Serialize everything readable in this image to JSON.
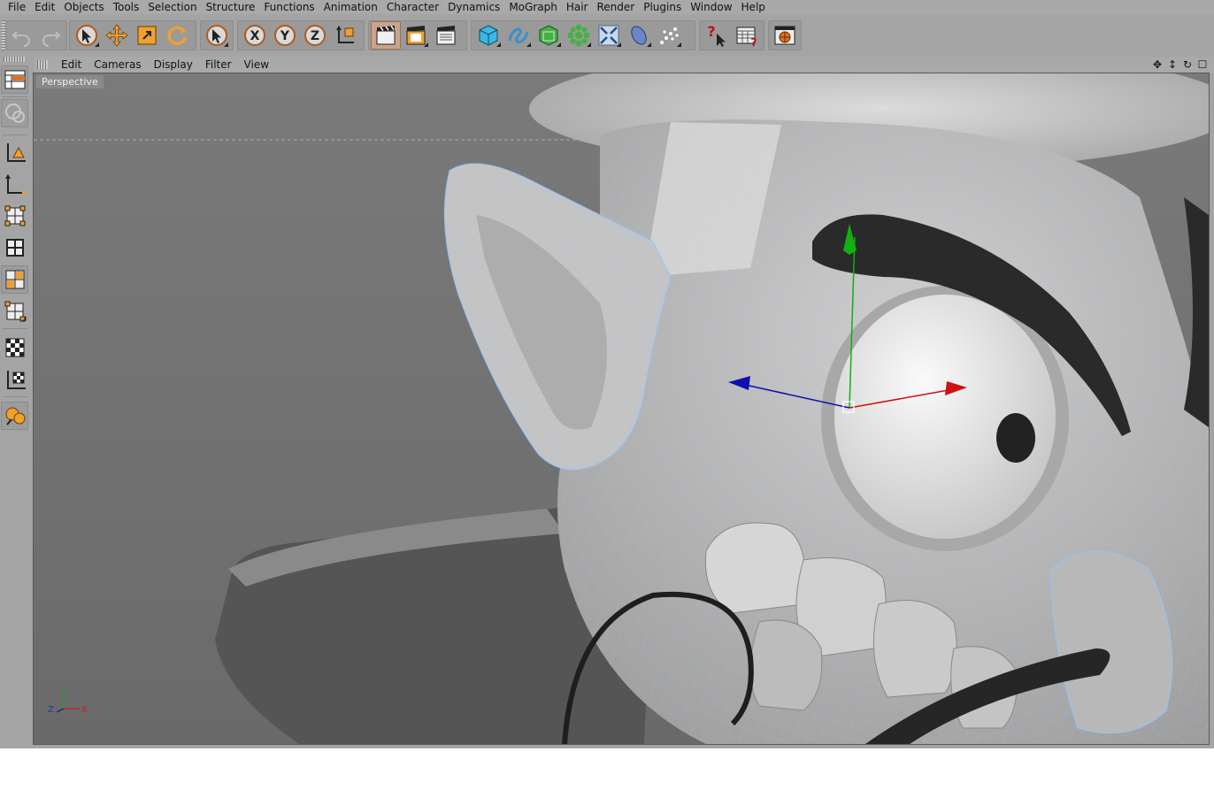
{
  "menubar": {
    "items": [
      "File",
      "Edit",
      "Objects",
      "Tools",
      "Selection",
      "Structure",
      "Functions",
      "Animation",
      "Character",
      "Dynamics",
      "MoGraph",
      "Hair",
      "Render",
      "Plugins",
      "Window",
      "Help"
    ]
  },
  "toolbar": {
    "groups": [
      [
        "undo-icon",
        "redo-icon"
      ],
      [
        "live-selection-icon",
        "move-icon",
        "scale-icon",
        "rotate-icon"
      ],
      [
        "selection-tool-icon"
      ],
      [
        "x-axis-lock-icon",
        "y-axis-lock-icon",
        "z-axis-lock-icon",
        "coordinate-system-icon"
      ],
      [
        "render-view-icon",
        "render-picture-viewer-icon",
        "render-settings-icon"
      ],
      [
        "cube-primitive-icon",
        "spline-icon",
        "nurbs-icon",
        "array-icon",
        "deformer-icon",
        "scene-object-icon",
        "particle-icon"
      ],
      [
        "help-cursor-icon",
        "layout-manager-icon"
      ],
      [
        "web-icon"
      ]
    ]
  },
  "viewport": {
    "menu": [
      "Edit",
      "Cameras",
      "Display",
      "Filter",
      "View"
    ],
    "label": "Perspective",
    "gizmo_axes": {
      "z": "Z",
      "x": "X"
    }
  },
  "colors": {
    "accent": "#e8922a",
    "axis_x": "#d01010",
    "axis_y": "#10b010",
    "axis_z": "#1010b0",
    "wire": "#8ec6ff"
  }
}
